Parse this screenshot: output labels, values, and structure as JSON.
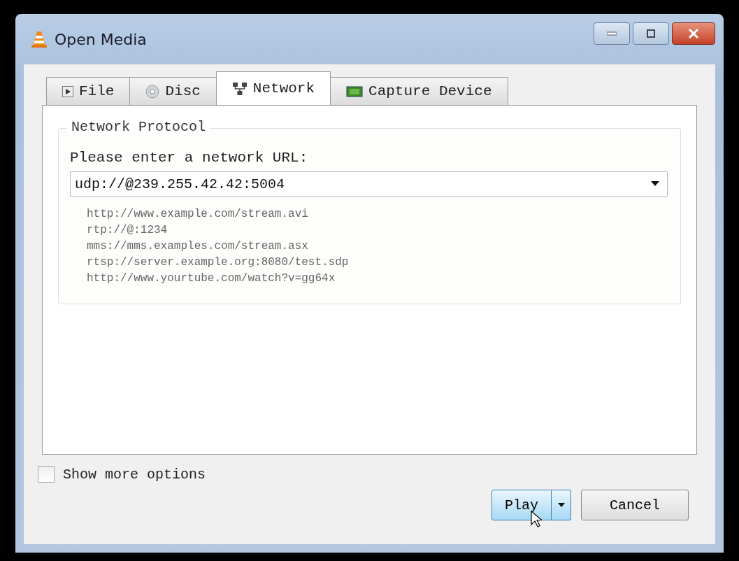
{
  "window": {
    "title": "Open Media"
  },
  "tabs": [
    {
      "label": "File",
      "selected": false,
      "kind": "file"
    },
    {
      "label": "Disc",
      "selected": false,
      "kind": "disc"
    },
    {
      "label": "Network",
      "selected": true,
      "kind": "network"
    },
    {
      "label": "Capture Device",
      "selected": false,
      "kind": "capture"
    }
  ],
  "group": {
    "title": "Network Protocol",
    "prompt": "Please enter a network URL:",
    "url_value": "udp://@239.255.42.42:5004",
    "examples": [
      "http://www.example.com/stream.avi",
      "rtp://@:1234",
      "mms://mms.examples.com/stream.asx",
      "rtsp://server.example.org:8080/test.sdp",
      "http://www.yourtube.com/watch?v=gg64x"
    ]
  },
  "show_more_options": {
    "label": "Show more options",
    "checked": false
  },
  "buttons": {
    "play": "Play",
    "cancel": "Cancel"
  }
}
